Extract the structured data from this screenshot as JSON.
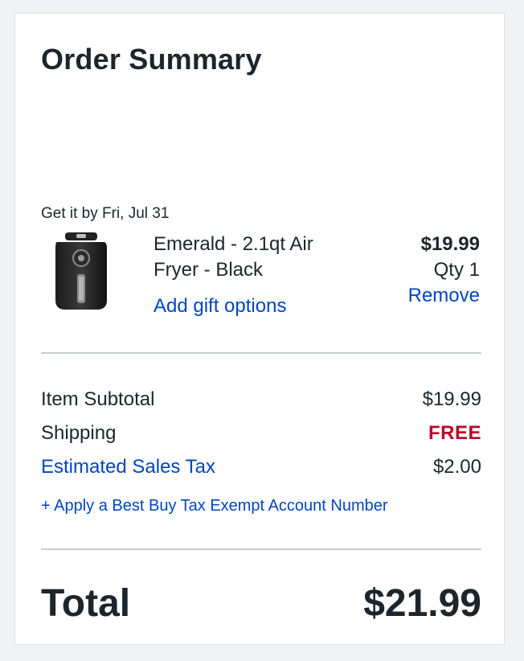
{
  "order_summary": {
    "title": "Order Summary",
    "delivery_text": "Get it by Fri, Jul 31",
    "item": {
      "name": "Emerald - 2.1qt Air Fryer - Black",
      "price": "$19.99",
      "qty": "Qty 1",
      "remove_label": "Remove",
      "gift_label": "Add gift options",
      "image_icon": "air-fryer-product-image"
    },
    "subtotal_label": "Item Subtotal",
    "subtotal_value": "$19.99",
    "shipping_label": "Shipping",
    "shipping_value": "FREE",
    "tax_label": "Estimated Sales Tax",
    "tax_value": "$2.00",
    "exempt_link": "+ Apply a Best Buy Tax Exempt Account Number",
    "total_label": "Total",
    "total_value": "$21.99"
  },
  "colors": {
    "link": "#0046be",
    "free": "#bb0628",
    "text": "#1d252c",
    "divider": "#c5cbd5",
    "page_bg": "#f0f2f4"
  }
}
